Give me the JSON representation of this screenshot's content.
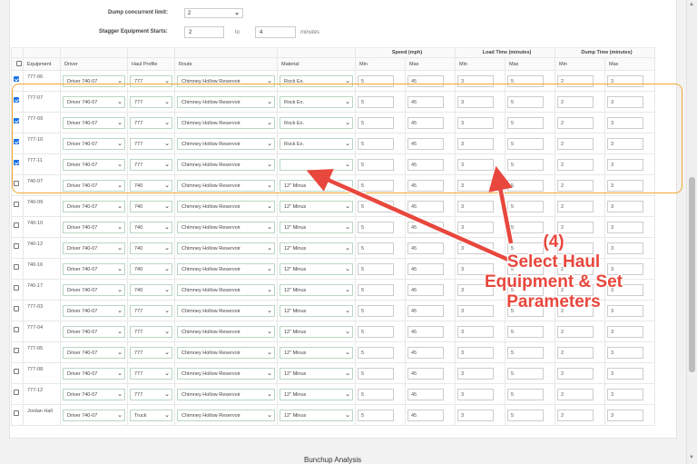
{
  "settings": {
    "dump_limit_label": "Dump concurrent limit:",
    "dump_limit_value": "2",
    "stagger_label": "Stagger Equipment Starts:",
    "stagger_from": "2",
    "stagger_to_label": "to",
    "stagger_to": "4",
    "stagger_unit": "minutes"
  },
  "table": {
    "group_headers": {
      "speed": "Speed (mph)",
      "load": "Load Time (minutes)",
      "dump": "Dump Time (minutes)"
    },
    "columns": {
      "equipment": "Equipment",
      "driver": "Driver",
      "haul_profile": "Haul Profile",
      "route": "Route",
      "material": "Material",
      "min": "Min",
      "max": "Max"
    },
    "rows": [
      {
        "checked": true,
        "equipment": "777-06",
        "driver": "Driver 740-07",
        "profile": "777",
        "route": "Chimney Hollow Reservoir",
        "material": "Rock Ex.",
        "speed_min": "5",
        "speed_max": "45",
        "load_min": "3",
        "load_max": "5",
        "dump_min": "2",
        "dump_max": "3"
      },
      {
        "checked": true,
        "equipment": "777-07",
        "driver": "Driver 740-07",
        "profile": "777",
        "route": "Chimney Hollow Reservoir",
        "material": "Rock Ex.",
        "speed_min": "5",
        "speed_max": "45",
        "load_min": "3",
        "load_max": "5",
        "dump_min": "2",
        "dump_max": "3"
      },
      {
        "checked": true,
        "equipment": "777-09",
        "driver": "Driver 740-07",
        "profile": "777",
        "route": "Chimney Hollow Reservoir",
        "material": "Rock Ex.",
        "speed_min": "5",
        "speed_max": "45",
        "load_min": "3",
        "load_max": "5",
        "dump_min": "2",
        "dump_max": "3"
      },
      {
        "checked": true,
        "equipment": "777-10",
        "driver": "Driver 740-07",
        "profile": "777",
        "route": "Chimney Hollow Reservoir",
        "material": "Rock Ex.",
        "speed_min": "5",
        "speed_max": "45",
        "load_min": "3",
        "load_max": "5",
        "dump_min": "2",
        "dump_max": "3"
      },
      {
        "checked": true,
        "equipment": "777-11",
        "driver": "Driver 740-07",
        "profile": "777",
        "route": "Chimney Hollow Reservoir",
        "material": "",
        "speed_min": "5",
        "speed_max": "45",
        "load_min": "3",
        "load_max": "5",
        "dump_min": "2",
        "dump_max": "3"
      },
      {
        "checked": false,
        "equipment": "740-07",
        "driver": "Driver 740-07",
        "profile": "740",
        "route": "Chimney Hollow Reservoir",
        "material": "12\" Minus",
        "speed_min": "5",
        "speed_max": "45",
        "load_min": "3",
        "load_max": "5",
        "dump_min": "2",
        "dump_max": "3"
      },
      {
        "checked": false,
        "equipment": "740-09",
        "driver": "Driver 740-07",
        "profile": "740",
        "route": "Chimney Hollow Reservoir",
        "material": "12\" Minus",
        "speed_min": "5",
        "speed_max": "45",
        "load_min": "3",
        "load_max": "5",
        "dump_min": "2",
        "dump_max": "3"
      },
      {
        "checked": false,
        "equipment": "740-10",
        "driver": "Driver 740-07",
        "profile": "740",
        "route": "Chimney Hollow Reservoir",
        "material": "12\" Minus",
        "speed_min": "5",
        "speed_max": "45",
        "load_min": "3",
        "load_max": "5",
        "dump_min": "2",
        "dump_max": "3"
      },
      {
        "checked": false,
        "equipment": "740-12",
        "driver": "Driver 740-07",
        "profile": "740",
        "route": "Chimney Hollow Reservoir",
        "material": "12\" Minus",
        "speed_min": "5",
        "speed_max": "45",
        "load_min": "3",
        "load_max": "5",
        "dump_min": "2",
        "dump_max": "3"
      },
      {
        "checked": false,
        "equipment": "740-16",
        "driver": "Driver 740-07",
        "profile": "740",
        "route": "Chimney Hollow Reservoir",
        "material": "12\" Minus",
        "speed_min": "5",
        "speed_max": "45",
        "load_min": "3",
        "load_max": "5",
        "dump_min": "2",
        "dump_max": "3"
      },
      {
        "checked": false,
        "equipment": "740-17",
        "driver": "Driver 740-07",
        "profile": "740",
        "route": "Chimney Hollow Reservoir",
        "material": "12\" Minus",
        "speed_min": "5",
        "speed_max": "45",
        "load_min": "3",
        "load_max": "5",
        "dump_min": "2",
        "dump_max": "3"
      },
      {
        "checked": false,
        "equipment": "777-03",
        "driver": "Driver 740-07",
        "profile": "777",
        "route": "Chimney Hollow Reservoir",
        "material": "12\" Minus",
        "speed_min": "5",
        "speed_max": "45",
        "load_min": "3",
        "load_max": "5",
        "dump_min": "2",
        "dump_max": "3"
      },
      {
        "checked": false,
        "equipment": "777-04",
        "driver": "Driver 740-07",
        "profile": "777",
        "route": "Chimney Hollow Reservoir",
        "material": "12\" Minus",
        "speed_min": "5",
        "speed_max": "45",
        "load_min": "3",
        "load_max": "5",
        "dump_min": "2",
        "dump_max": "3"
      },
      {
        "checked": false,
        "equipment": "777-05",
        "driver": "Driver 740-07",
        "profile": "777",
        "route": "Chimney Hollow Reservoir",
        "material": "12\" Minus",
        "speed_min": "5",
        "speed_max": "45",
        "load_min": "3",
        "load_max": "5",
        "dump_min": "2",
        "dump_max": "3"
      },
      {
        "checked": false,
        "equipment": "777-08",
        "driver": "Driver 740-07",
        "profile": "777",
        "route": "Chimney Hollow Reservoir",
        "material": "12\" Minus",
        "speed_min": "5",
        "speed_max": "45",
        "load_min": "3",
        "load_max": "5",
        "dump_min": "2",
        "dump_max": "3"
      },
      {
        "checked": false,
        "equipment": "777-12",
        "driver": "Driver 740-07",
        "profile": "777",
        "route": "Chimney Hollow Reservoir",
        "material": "12\" Minus",
        "speed_min": "5",
        "speed_max": "45",
        "load_min": "3",
        "load_max": "5",
        "dump_min": "2",
        "dump_max": "3"
      },
      {
        "checked": false,
        "equipment": "Jordan Hall",
        "driver": "Driver 740-07",
        "profile": "Truck",
        "route": "Chimney Hollow Reservoir",
        "material": "12\" Minus",
        "speed_min": "5",
        "speed_max": "45",
        "load_min": "3",
        "load_max": "5",
        "dump_min": "2",
        "dump_max": "3"
      }
    ]
  },
  "annotation": {
    "step": "(4)",
    "line1": "Select Haul",
    "line2": "Equipment & Set",
    "line3": "Parameters",
    "color": "#e8473d",
    "highlight_color": "#f0a830"
  },
  "footer": {
    "section_title": "Bunchup Analysis"
  }
}
